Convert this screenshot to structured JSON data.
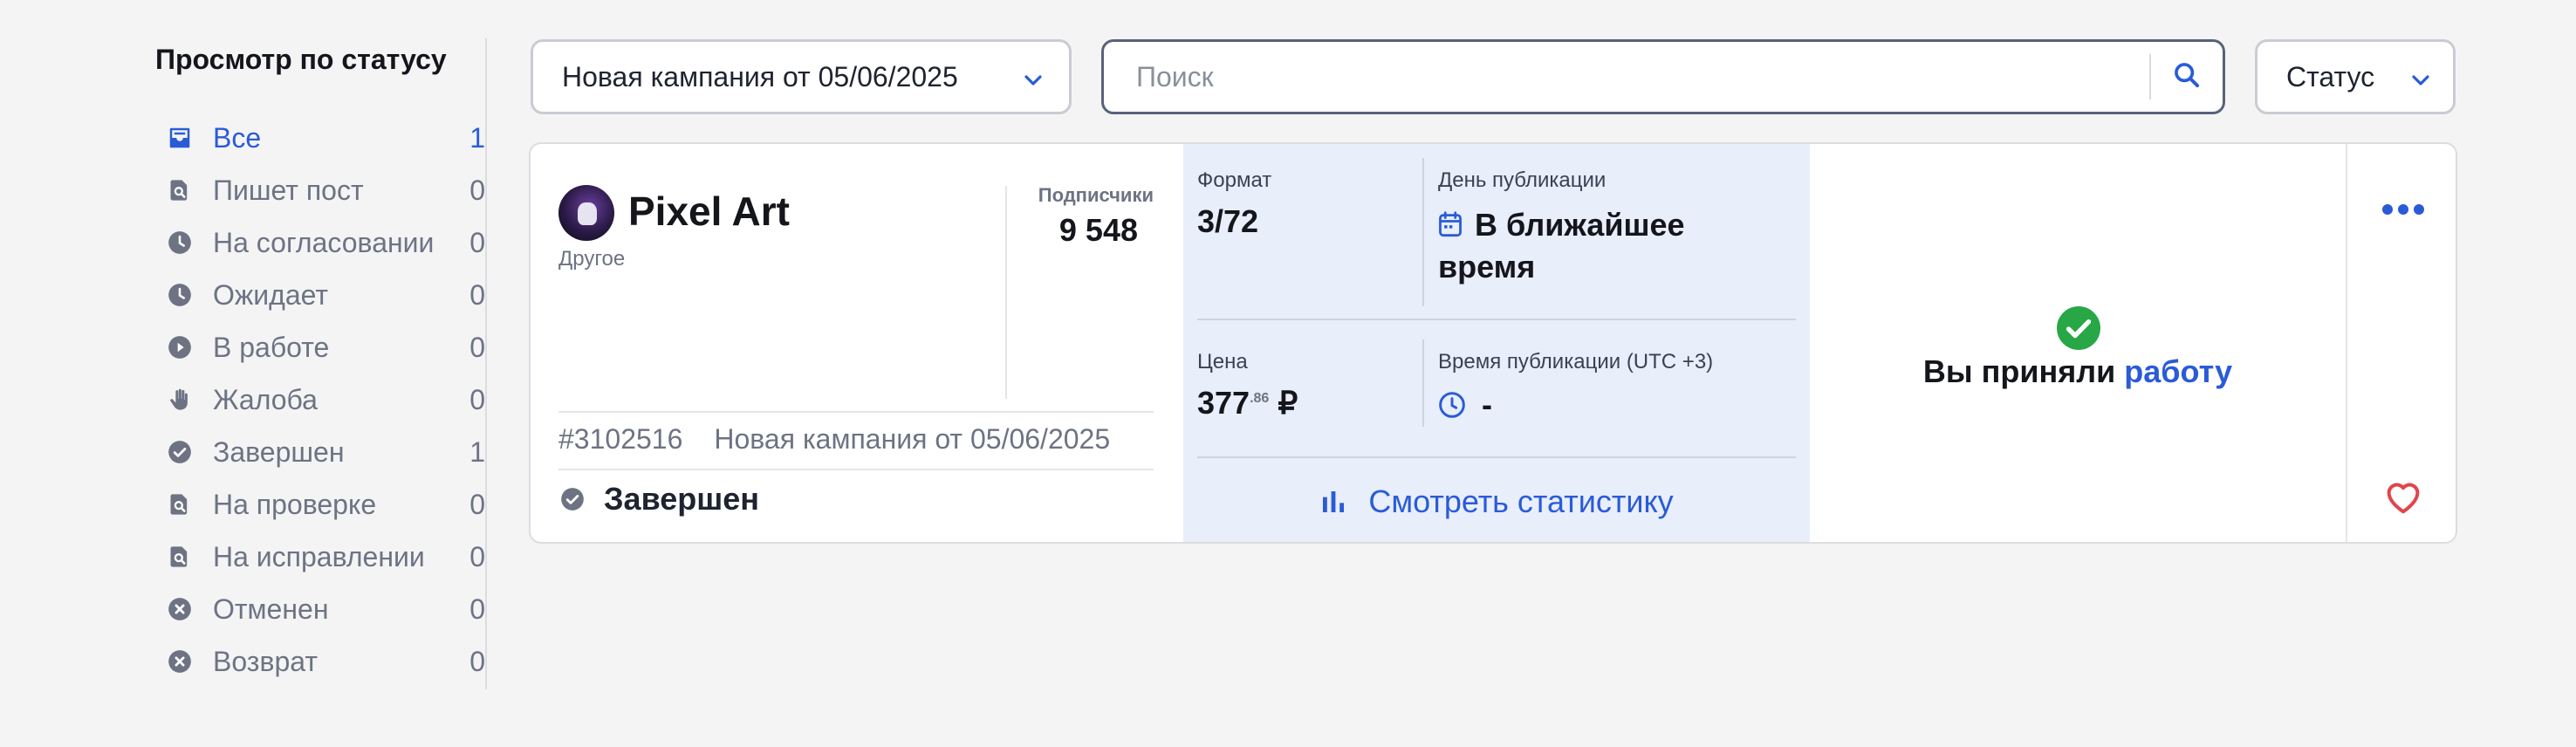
{
  "sidebar": {
    "title": "Просмотр по статусу",
    "items": [
      {
        "label": "Все",
        "count": "1",
        "icon": "inbox-icon"
      },
      {
        "label": "Пишет пост",
        "count": "0",
        "icon": "document-search-icon"
      },
      {
        "label": "На согласовании",
        "count": "0",
        "icon": "clock-icon"
      },
      {
        "label": "Ожидает",
        "count": "0",
        "icon": "clock-icon"
      },
      {
        "label": "В работе",
        "count": "0",
        "icon": "play-icon"
      },
      {
        "label": "Жалоба",
        "count": "0",
        "icon": "hand-icon"
      },
      {
        "label": "Завершен",
        "count": "1",
        "icon": "check-circle-icon"
      },
      {
        "label": "На проверке",
        "count": "0",
        "icon": "document-search-icon"
      },
      {
        "label": "На исправлении",
        "count": "0",
        "icon": "document-search-icon"
      },
      {
        "label": "Отменен",
        "count": "0",
        "icon": "x-circle-icon"
      },
      {
        "label": "Возврат",
        "count": "0",
        "icon": "x-circle-icon"
      }
    ]
  },
  "filters": {
    "campaign": "Новая кампания от 05/06/2025",
    "search_placeholder": "Поиск",
    "status": "Статус"
  },
  "card": {
    "channel_name": "Pixel Art",
    "category": "Другое",
    "subscribers_label": "Подписчики",
    "subscribers_value": "9 548",
    "order_id": "#3102516",
    "campaign_name": "Новая кампания от 05/06/2025",
    "status": "Завершен",
    "format_label": "Формат",
    "format_value": "3/72",
    "pub_day_label": "День публикации",
    "pub_day_value": "В ближайшее время",
    "price_label": "Цена",
    "price_main": "377",
    "price_fraction": ".86",
    "price_currency": "₽",
    "pub_time_label": "Время публикации (UTC +3)",
    "pub_time_value": "-",
    "stats_button": "Смотреть статистику",
    "accept_text": "Вы приняли",
    "accept_link": "работу"
  },
  "colors": {
    "accent": "#2a5bd7",
    "success": "#27a745",
    "favorite": "#e0454b",
    "info_panel_bg": "#e8eefa"
  }
}
